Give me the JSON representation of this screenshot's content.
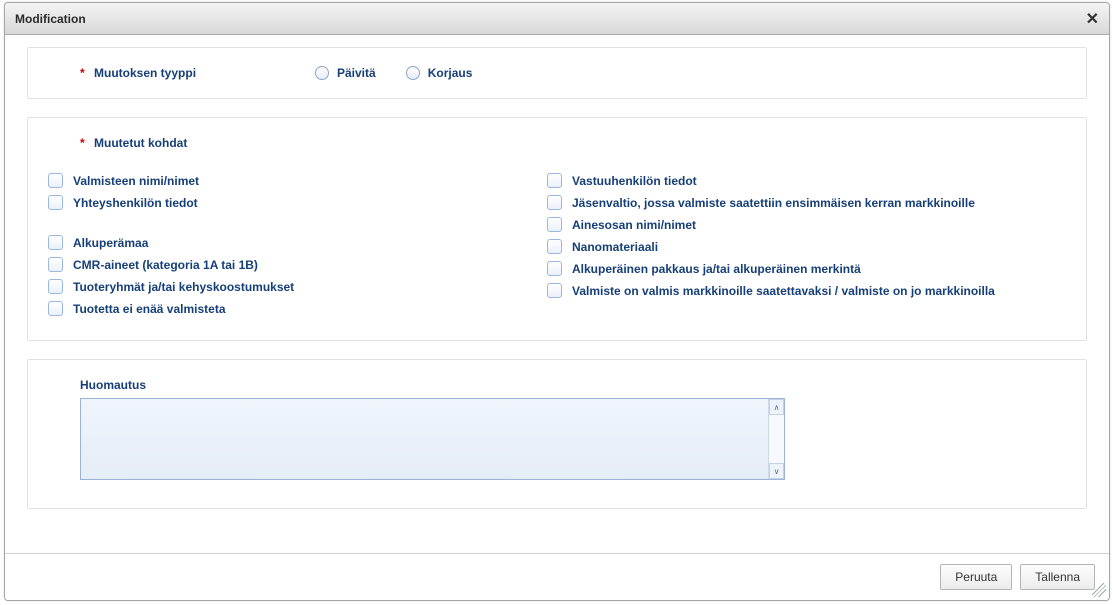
{
  "dialog": {
    "title": "Modification"
  },
  "type_section": {
    "label": "Muutoksen tyyppi",
    "options": {
      "update": "Päivitä",
      "correction": "Korjaus"
    }
  },
  "changed_section": {
    "label": "Muutetut kohdat",
    "left": [
      {
        "label": "Valmisteen nimi/nimet"
      },
      {
        "label": "Yhteyshenkilön tiedot"
      },
      {
        "label": "Alkuperämaa",
        "gap_before": true
      },
      {
        "label": "CMR-aineet (kategoria 1A tai 1B)"
      },
      {
        "label": "Tuoteryhmät ja/tai kehyskoostumukset"
      },
      {
        "label": "Tuotetta ei enää valmisteta"
      }
    ],
    "right": [
      {
        "label": "Vastuuhenkilön tiedot"
      },
      {
        "label": "Jäsenvaltio, jossa valmiste saatettiin ensimmäisen kerran markkinoille"
      },
      {
        "label": "Ainesosan nimi/nimet"
      },
      {
        "label": "Nanomateriaali"
      },
      {
        "label": "Alkuperäinen pakkaus ja/tai alkuperäinen merkintä"
      },
      {
        "label": "Valmiste on valmis markkinoille saatettavaksi / valmiste on jo markkinoilla"
      }
    ]
  },
  "remark": {
    "label": "Huomautus",
    "value": ""
  },
  "buttons": {
    "cancel": "Peruuta",
    "save": "Tallenna"
  }
}
